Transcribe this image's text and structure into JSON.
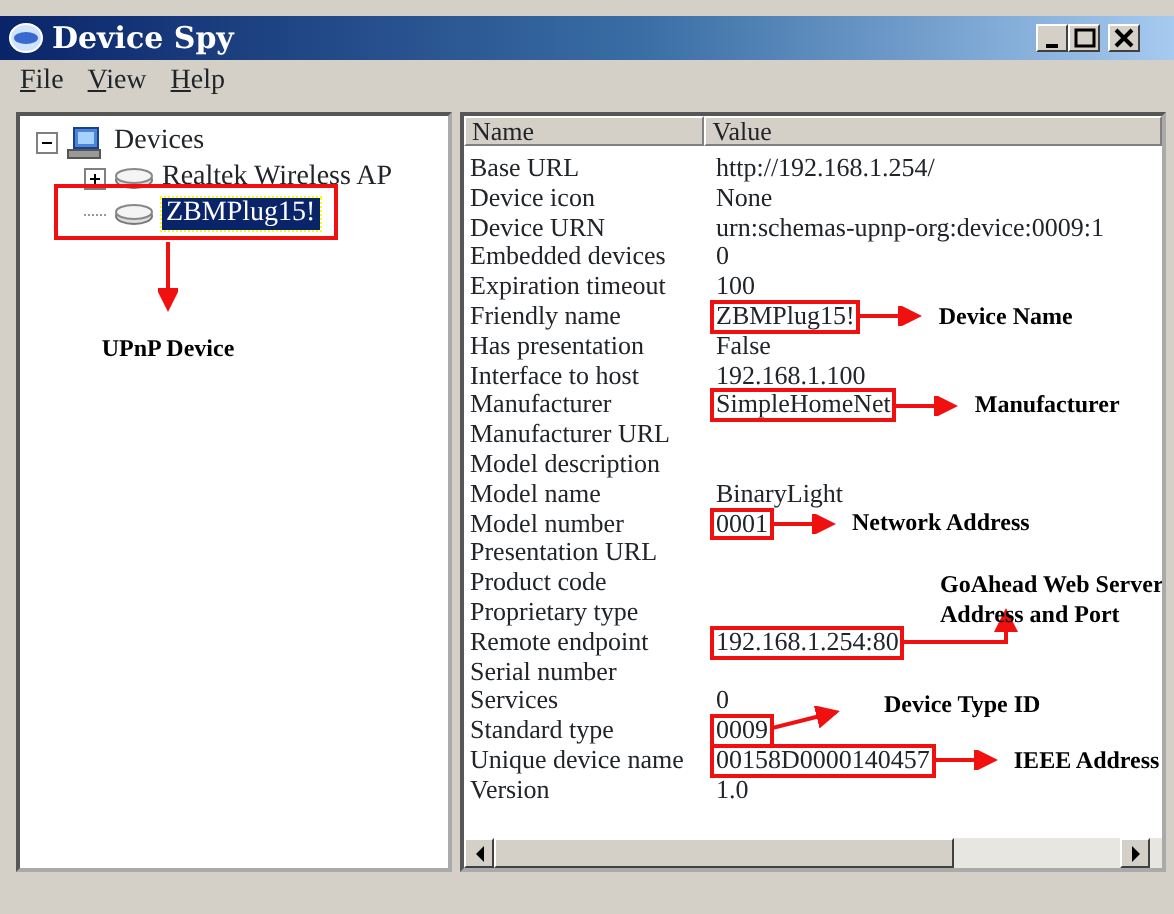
{
  "window": {
    "title": "Device Spy"
  },
  "menu": [
    "File",
    "View",
    "Help"
  ],
  "tree": [
    {
      "label": "Devices",
      "kind": "computer",
      "expanded": true,
      "selected": false,
      "children": [
        {
          "label": "Realtek Wireless AP",
          "kind": "device",
          "expanded": false,
          "selected": false
        },
        {
          "label": "ZBMPlug15!",
          "kind": "device",
          "selected": true,
          "note": "UPnP Device"
        }
      ]
    }
  ],
  "table": {
    "columns": [
      "Name",
      "Value"
    ],
    "rows": [
      {
        "name": "Base URL",
        "value": "http://192.168.1.254/"
      },
      {
        "name": "Device icon",
        "value": "None"
      },
      {
        "name": "Device URN",
        "value": "urn:schemas-upnp-org:device:0009:1"
      },
      {
        "name": "Embedded devices",
        "value": "0"
      },
      {
        "name": "Expiration timeout",
        "value": "100"
      },
      {
        "name": "Friendly name",
        "value": "ZBMPlug15!",
        "note": {
          "text": "Device Name",
          "kind": "inline"
        }
      },
      {
        "name": "Has presentation",
        "value": "False"
      },
      {
        "name": "Interface to host",
        "value": "192.168.1.100"
      },
      {
        "name": "Manufacturer",
        "value": "SimpleHomeNet",
        "note": {
          "text": "Manufacturer",
          "kind": "inline"
        }
      },
      {
        "name": "Manufacturer URL"
      },
      {
        "name": "Model description"
      },
      {
        "name": "Model name",
        "value": "BinaryLight"
      },
      {
        "name": "Model number",
        "value": "0001",
        "note": {
          "text": "Network Address",
          "kind": "inline"
        }
      },
      {
        "name": "Presentation URL"
      },
      {
        "name": "Product code"
      },
      {
        "name": "Proprietary type"
      },
      {
        "name": "Remote endpoint",
        "value": "192.168.1.254:80",
        "note": {
          "text": "GoAhead Web Server Address and Port",
          "kind": "above"
        }
      },
      {
        "name": "Serial number"
      },
      {
        "name": "Services",
        "value": "0"
      },
      {
        "name": "Standard type",
        "value": "0009",
        "note": {
          "text": "Device Type ID",
          "kind": "up"
        }
      },
      {
        "name": "Unique device name",
        "value": "00158D0000140457",
        "note": {
          "text": "IEEE Address",
          "kind": "inline"
        }
      },
      {
        "name": "Version",
        "value": "1.0"
      }
    ]
  }
}
